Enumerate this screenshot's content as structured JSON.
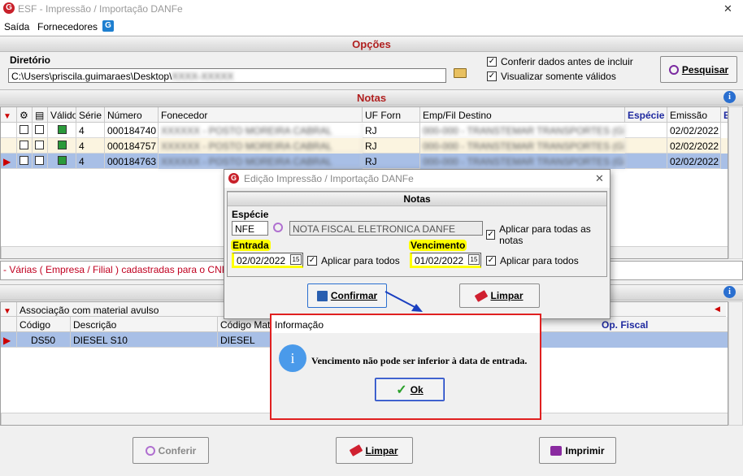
{
  "window": {
    "title": "ESF - Impressão / Importação DANFe",
    "close": "✕"
  },
  "menu": {
    "items": [
      "Saída",
      "Fornecedores"
    ],
    "app_icon": "G"
  },
  "opcoes": {
    "header": "Opções",
    "diretorio_label": "Diretório",
    "diretorio_value": "C:\\Users\\priscila.guimaraes\\Desktop\\",
    "diretorio_redacted": "XXXX-XXXXX",
    "chk_conferir": "Conferir dados antes de incluir",
    "chk_validos": "Visualizar somente válidos",
    "pesquisar": "Pesquisar"
  },
  "notas": {
    "header": "Notas",
    "columns": [
      "Válido",
      "Série",
      "Número",
      "Fonecedor",
      "UF Forn",
      "Emp/Fil Destino",
      "Espécie",
      "Emissão",
      "E"
    ],
    "rows": [
      {
        "serie": "4",
        "numero": "000184740",
        "fornecedor": "XXXXXX - POSTO MOREIRA CABRAL",
        "uf": "RJ",
        "destino": "000-000 - TRANSTEMAR TRANSPORTES (GRILL)",
        "emissao": "02/02/2022"
      },
      {
        "serie": "4",
        "numero": "000184757",
        "fornecedor": "XXXXXX - POSTO MOREIRA CABRAL",
        "uf": "RJ",
        "destino": "000-000 - TRANSTEMAR TRANSPORTES (GRILL)",
        "emissao": "02/02/2022"
      },
      {
        "serie": "4",
        "numero": "000184763",
        "fornecedor": "XXXXXX - POSTO MOREIRA CABRAL",
        "uf": "RJ",
        "destino": "000-000 - TRANSTEMAR TRANSPORTES (GRILL)",
        "emissao": "02/02/2022"
      }
    ],
    "msg": "- Várias ( Empresa / Filial ) cadastradas para o CNPJ 00.4("
  },
  "assoc": {
    "header": "Associação com material avulso",
    "columns": [
      "Código",
      "Descrição",
      "Código Mater",
      "Op. Fiscal"
    ],
    "row": {
      "codigo": "DS50",
      "descricao": "DIESEL S10",
      "codmat": "DIESEL"
    }
  },
  "bottom": {
    "conferir": "Conferir",
    "limpar": "Limpar",
    "imprimir": "Imprimir"
  },
  "dialog": {
    "title": "Edição Impressão / Importação DANFe",
    "header": "Notas",
    "especie_label": "Espécie",
    "especie_value": "NFE",
    "especie_desc": "NOTA FISCAL ELETRONICA DANFE",
    "aplicar_todas": "Aplicar para todas as notas",
    "entrada_label": "Entrada",
    "entrada_value": "02/02/2022",
    "aplicar_todos": "Aplicar para todos",
    "vencimento_label": "Vencimento",
    "vencimento_value": "01/02/2022",
    "confirmar": "Confirmar",
    "limpar": "Limpar",
    "calendar": "15"
  },
  "info": {
    "title": "Informação",
    "message": "Vencimento não pode ser inferior à data de entrada.",
    "ok": "Ok"
  },
  "colors": {
    "accent": "#b02020",
    "selected_row": "#a8bfe6",
    "highlight": "#ffff00",
    "info_border": "#e02020"
  }
}
